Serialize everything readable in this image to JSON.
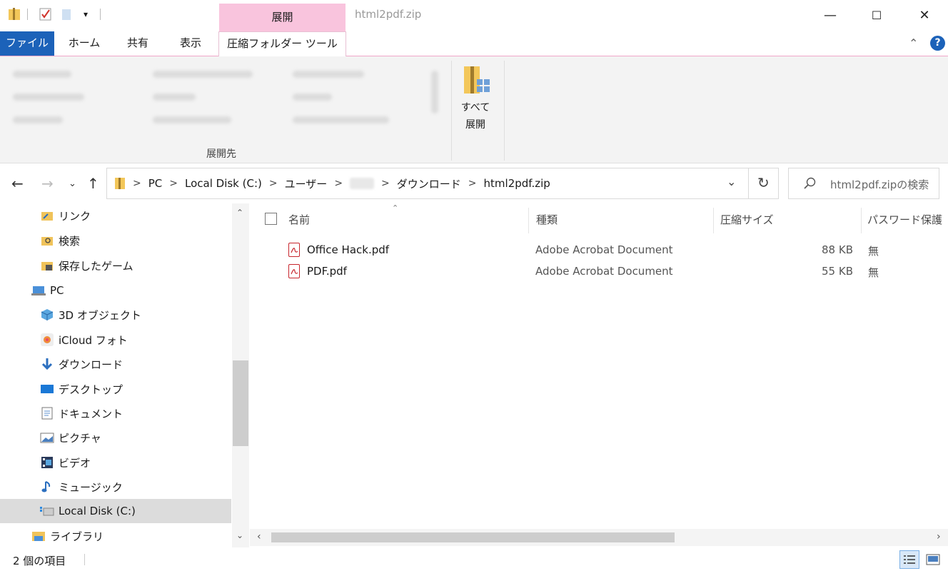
{
  "titlebar": {
    "context_tab": "展開",
    "window_title": "html2pdf.zip",
    "minimize": "—",
    "maximize": "☐",
    "close": "✕"
  },
  "ribbon_tabs": {
    "file": "ファイル",
    "home": "ホーム",
    "share": "共有",
    "view": "表示",
    "compressed_tools": "圧縮フォルダー ツール",
    "collapse": "⌃",
    "help": "?"
  },
  "ribbon": {
    "group_label": "展開先",
    "extract_all_line1": "すべて",
    "extract_all_line2": "展開"
  },
  "address": {
    "crumbs": [
      "PC",
      "Local Disk (C:)",
      "ユーザー",
      "ダウンロード",
      "html2pdf.zip"
    ],
    "refresh": "↻",
    "dropdown": "⌄"
  },
  "search": {
    "placeholder": "html2pdf.zipの検索"
  },
  "nav": {
    "back": "←",
    "forward": "→",
    "recent": "⌄",
    "up": "↑",
    "items": [
      {
        "label": "リンク",
        "icon": "link-folder-icon"
      },
      {
        "label": "検索",
        "icon": "search-folder-icon"
      },
      {
        "label": "保存したゲーム",
        "icon": "saved-games-icon"
      },
      {
        "label": "PC",
        "icon": "pc-icon"
      },
      {
        "label": "3D オブジェクト",
        "icon": "3d-objects-icon"
      },
      {
        "label": "iCloud フォト",
        "icon": "icloud-photos-icon"
      },
      {
        "label": "ダウンロード",
        "icon": "download-icon"
      },
      {
        "label": "デスクトップ",
        "icon": "desktop-icon"
      },
      {
        "label": "ドキュメント",
        "icon": "documents-icon"
      },
      {
        "label": "ピクチャ",
        "icon": "pictures-icon"
      },
      {
        "label": "ビデオ",
        "icon": "videos-icon"
      },
      {
        "label": "ミュージック",
        "icon": "music-icon"
      },
      {
        "label": "Local Disk (C:)",
        "icon": "local-disk-icon"
      },
      {
        "label": "ライブラリ",
        "icon": "library-icon"
      }
    ]
  },
  "columns": {
    "name": "名前",
    "type": "種類",
    "compressed_size": "圧縮サイズ",
    "password": "パスワード保護"
  },
  "files": [
    {
      "name": "Office Hack.pdf",
      "type": "Adobe Acrobat Document",
      "size": "88 KB",
      "password": "無"
    },
    {
      "name": "PDF.pdf",
      "type": "Adobe Acrobat Document",
      "size": "55 KB",
      "password": "無"
    }
  ],
  "status": {
    "item_count": "2 個の項目"
  },
  "colors": {
    "file_tab": "#1c62b9",
    "context_tab": "#f9c4dd",
    "selected_nav": "#dcdcdc",
    "pdf_red": "#c7262d"
  }
}
